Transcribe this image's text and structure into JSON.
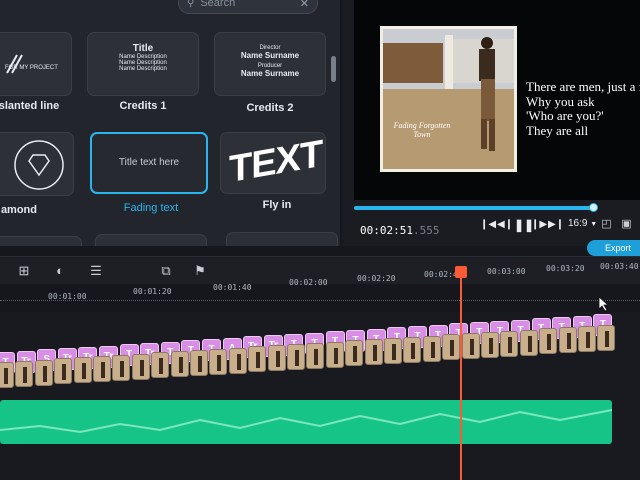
{
  "search": {
    "placeholder": "Search",
    "clear_icon": "close-icon"
  },
  "titles": [
    {
      "label": "slanted line",
      "preview_lines": [
        "FOR MY PROJECT"
      ],
      "style": "slanted"
    },
    {
      "label": "Credits 1",
      "preview_lines": [
        "Title",
        "Name Description",
        "Name Description",
        "Name Description"
      ],
      "style": "credits1"
    },
    {
      "label": "Credits 2",
      "preview_lines": [
        "Director",
        "Name Surname",
        "Producer",
        "Name Surname"
      ],
      "style": "credits2"
    },
    {
      "label": "amond",
      "preview_lines": [],
      "style": "diamond"
    },
    {
      "label": "Fading text",
      "preview_lines": [
        "Title text here"
      ],
      "style": "fading",
      "selected": true
    },
    {
      "label": "Fly in",
      "preview_lines": [
        "TEXT"
      ],
      "style": "flyin"
    }
  ],
  "preview": {
    "still_caption_lines": [
      "Fading Forgotten",
      "Town"
    ],
    "caption_lines": [
      "There are men, just a few",
      "Why you ask",
      "'Who are you?'",
      "They are all"
    ],
    "timecode_main": "00:02:51",
    "timecode_ms": ".555",
    "progress": 0.99,
    "aspect_ratio": "16:9",
    "accent": "#2ab5ef"
  },
  "export_label": "Export",
  "toolbar_icons": [
    "crop-icon",
    "color-icon",
    "adjust-icon",
    "snapshot-icon",
    "marker-icon"
  ],
  "ruler_labels": [
    "00:01:00",
    "00:01:20",
    "00:01:40",
    "00:02:00",
    "00:02:20",
    "00:02:40",
    "00:03:00",
    "00:03:20",
    "00:03:40"
  ],
  "title_clip_labels": [
    "T",
    "Tr",
    "S",
    "Tr",
    "Tr",
    "Tr",
    "T",
    "Tr",
    "T",
    "T",
    "T",
    "A",
    "Tr",
    "Tr",
    "T",
    "T",
    "T",
    "T",
    "T",
    "T",
    "T",
    "T",
    "T",
    "T",
    "T",
    "T",
    "T",
    "T",
    "T",
    "T"
  ],
  "colors": {
    "title_clip": "#d98ee6",
    "audio_clip": "#17c488",
    "playhead": "#ff5a36"
  }
}
